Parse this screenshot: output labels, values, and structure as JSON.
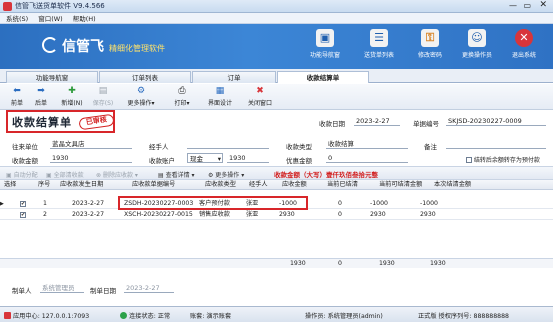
{
  "window": {
    "title": "信管飞送货单软件 V9.4.566"
  },
  "menu": [
    {
      "label": "系统(S)"
    },
    {
      "label": "窗口(W)"
    },
    {
      "label": "帮助(H)"
    }
  ],
  "banner": {
    "brand": "信管飞",
    "slogan": "精细化管理软件",
    "buttons": [
      {
        "label": "功能导航窗",
        "icon": "monitor-icon"
      },
      {
        "label": "送货单列表",
        "icon": "list-icon"
      },
      {
        "label": "修改密码",
        "icon": "lock-icon"
      },
      {
        "label": "更换操作员",
        "icon": "user-icon"
      },
      {
        "label": "退出系统",
        "icon": "close-icon"
      }
    ]
  },
  "tabs": [
    {
      "label": "功能导航窗"
    },
    {
      "label": "订单列表"
    },
    {
      "label": "订单"
    },
    {
      "label": "收款结算单",
      "active": true
    }
  ],
  "toolbar": {
    "prev": "前单",
    "next": "后单",
    "new": "新增(N)",
    "save": "保存(S)",
    "more": "更多操作",
    "print": "打印",
    "design": "界面设计",
    "close": "关闭窗口"
  },
  "form": {
    "doc_title": "收款结算单",
    "stamp": "已审核",
    "date_label": "收款日期",
    "date_value": "2023-2-27",
    "no_label": "单据编号",
    "no_value": "SKJSD-20230227-0009",
    "customer_label": "往来单位",
    "customer_value": "蓝晶文具店",
    "handler_label": "经手人",
    "handler_value": "",
    "type_label": "收款类型",
    "type_value": "收款结算",
    "remark_label": "备注",
    "remark_value": "",
    "amount_label": "收款金额",
    "amount_value": "1930",
    "account_label": "收款账户",
    "account_value": "现金",
    "account_amount": "1930",
    "discount_label": "优惠金额",
    "discount_value": "0",
    "option_label": "结转后余额转存为预付款"
  },
  "gridbar": {
    "auto": "自动分配",
    "clear": "全部清收款",
    "delete": "删除应收款",
    "detail": "查看详情",
    "more": "更多操作",
    "amount_note": "收款金额（大写）壹仟玖佰叁拾元整"
  },
  "grid": {
    "headers": [
      "选择",
      "序号",
      "应收款发生日期",
      "应收款单据编号",
      "应收款类型",
      "经手人",
      "应收金额",
      "当前已结清",
      "当前可结清金额",
      "本次结清金额"
    ],
    "rows": [
      {
        "checked": "✔",
        "no": "1",
        "date": "2023-2-27",
        "code": "ZSDH-20230227-0003",
        "kind": "客户预付款",
        "handler": "张亚",
        "amount": "-1000",
        "settled": "0",
        "available": "-1000",
        "this_time": "-1000"
      },
      {
        "checked": "✔",
        "no": "2",
        "date": "2023-2-27",
        "code": "XSCH-20230227-0015",
        "kind": "销售应收款",
        "handler": "张亚",
        "amount": "2930",
        "settled": "0",
        "available": "2930",
        "this_time": "2930"
      }
    ],
    "totals": {
      "amount": "1930",
      "settled": "0",
      "available": "1930",
      "this_time": "1930"
    }
  },
  "footer": {
    "maker_label": "制单人",
    "maker_value": "系统管理员",
    "make_date_label": "制单日期",
    "make_date_value": "2023-2-27"
  },
  "status": {
    "center": "应用中心: 127.0.0.1:7093",
    "connection": "连接状态: 正常",
    "account": "账套: 演示账套",
    "operator": "操作员: 系统管理员(admin)",
    "edition": "正式版 授权序列号: 888888888"
  },
  "colors": {
    "banner": "#3c86d6",
    "highlight": "#d8262a",
    "stamp": "#d21f1f"
  }
}
